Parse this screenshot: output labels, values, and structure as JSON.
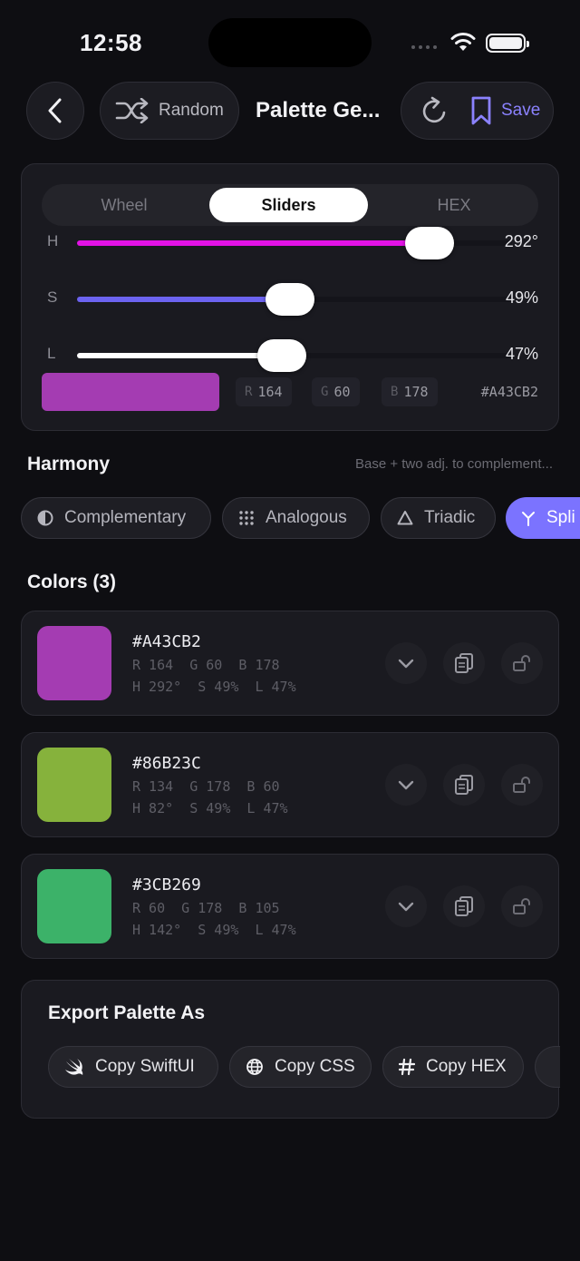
{
  "status_bar": {
    "time": "12:58"
  },
  "toolbar": {
    "random_label": "Random",
    "title": "Palette Ge...",
    "save_label": "Save"
  },
  "picker": {
    "modes": [
      "Wheel",
      "Sliders",
      "HEX"
    ],
    "active_mode": "Sliders",
    "sliders": [
      {
        "channel": "H",
        "value_text": "292°",
        "fraction": 0.811,
        "color": "#e312e6"
      },
      {
        "channel": "S",
        "value_text": "49%",
        "fraction": 0.49,
        "color": "#6c63f0"
      },
      {
        "channel": "L",
        "value_text": "47%",
        "fraction": 0.47,
        "color": "#ffffff"
      }
    ],
    "preview_color": "#A43CB2",
    "r": {
      "label": "R",
      "value": "164"
    },
    "g": {
      "label": "G",
      "value": "60"
    },
    "b": {
      "label": "B",
      "value": "178"
    },
    "hex": "#A43CB2"
  },
  "harmony": {
    "title": "Harmony",
    "description": "Base + two adj. to complement...",
    "options": [
      {
        "label": "Complementary",
        "icon": "half-circle-icon"
      },
      {
        "label": "Analogous",
        "icon": "dot-grid-icon"
      },
      {
        "label": "Triadic",
        "icon": "triangle-icon"
      },
      {
        "label": "Spli",
        "icon": "split-icon"
      }
    ],
    "active": "Spli"
  },
  "colors": {
    "title": "Colors  (3)",
    "items": [
      {
        "hex": "#A43CB2",
        "swatch": "#A43CB2",
        "rgb": "R 164  G 60  B 178",
        "hsl": "H 292°  S 49%  L 47%"
      },
      {
        "hex": "#86B23C",
        "swatch": "#86B23C",
        "rgb": "R 134  G 178  B 60",
        "hsl": "H 82°  S 49%  L 47%"
      },
      {
        "hex": "#3CB269",
        "swatch": "#3CB269",
        "rgb": "R 60  G 178  B 105",
        "hsl": "H 142°  S 49%  L 47%"
      }
    ]
  },
  "export": {
    "title": "Export Palette As",
    "buttons": [
      {
        "label": "Copy SwiftUI",
        "icon": "swift-icon"
      },
      {
        "label": "Copy CSS",
        "icon": "globe-icon"
      },
      {
        "label": "Copy HEX",
        "icon": "hash-icon"
      }
    ]
  },
  "theme": {
    "accent": "#7b73ff",
    "background": "#0e0e12",
    "card": "#1a1a20"
  }
}
